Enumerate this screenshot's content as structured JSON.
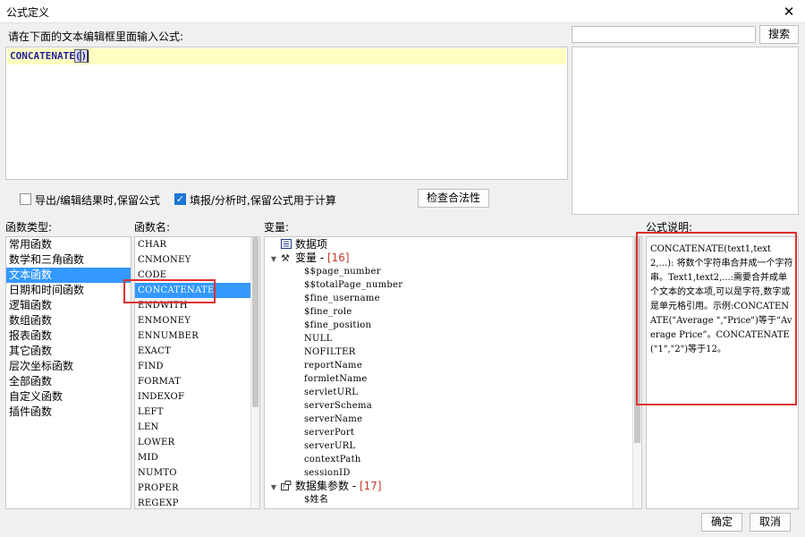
{
  "window": {
    "title": "公式定义"
  },
  "editor": {
    "label": "请在下面的文本编辑框里面输入公式:",
    "formula_name": "CONCATENATE",
    "paren_open": "(",
    "paren_close": ")"
  },
  "search": {
    "value": "",
    "button_label": "搜索"
  },
  "options": {
    "export_keep_formula": {
      "label": "导出/编辑结果时,保留公式",
      "checked": false
    },
    "fill_keep_formula": {
      "label": "填报/分析时,保留公式用于计算",
      "checked": true
    },
    "validate_button": "检查合法性"
  },
  "function_types": {
    "label": "函数类型:",
    "items": [
      "常用函数",
      "数学和三角函数",
      "文本函数",
      "日期和时间函数",
      "逻辑函数",
      "数组函数",
      "报表函数",
      "其它函数",
      "层次坐标函数",
      "全部函数",
      "自定义函数",
      "插件函数"
    ],
    "selected_index": 2
  },
  "function_names": {
    "label": "函数名:",
    "items": [
      "CHAR",
      "CNMONEY",
      "CODE",
      "CONCATENATE",
      "ENDWITH",
      "ENMONEY",
      "ENNUMBER",
      "EXACT",
      "FIND",
      "FORMAT",
      "INDEXOF",
      "LEFT",
      "LEN",
      "LOWER",
      "MID",
      "NUMTO",
      "PROPER",
      "REGEXP"
    ],
    "selected_index": 3
  },
  "variables": {
    "label": "变量:",
    "data_items": "数据项",
    "var_group": "变量",
    "var_count": "[16]",
    "var_items": [
      "$$page_number",
      "$$totalPage_number",
      "$fine_username",
      "$fine_role",
      "$fine_position",
      "NULL",
      "NOFILTER",
      "reportName",
      "formletName",
      "servletURL",
      "serverSchema",
      "serverName",
      "serverPort",
      "serverURL",
      "contextPath",
      "sessionID"
    ],
    "dataset_group": "数据集参数",
    "dataset_count": "[17]",
    "dataset_items": [
      "$姓名"
    ]
  },
  "description": {
    "label": "公式说明:",
    "text": "CONCATENATE(text1,text2,...): 将数个字符串合并成一个字符串。Text1,text2,...:需要合并成单个文本的文本项,可以是字符,数字或是单元格引用。示例:CONCATENATE(\"Average \",\"Price\")等于“Average Price”。CONCATENATE(\"1\",\"2\")等于12。"
  },
  "footer": {
    "ok_label": "确定",
    "cancel_label": "取消"
  },
  "colors": {
    "selection": "#3399ff",
    "highlight_box": "#e03030",
    "editor_line": "#ffffc2",
    "formula_text": "#1f1f9e",
    "var_count": "#c0392b"
  }
}
